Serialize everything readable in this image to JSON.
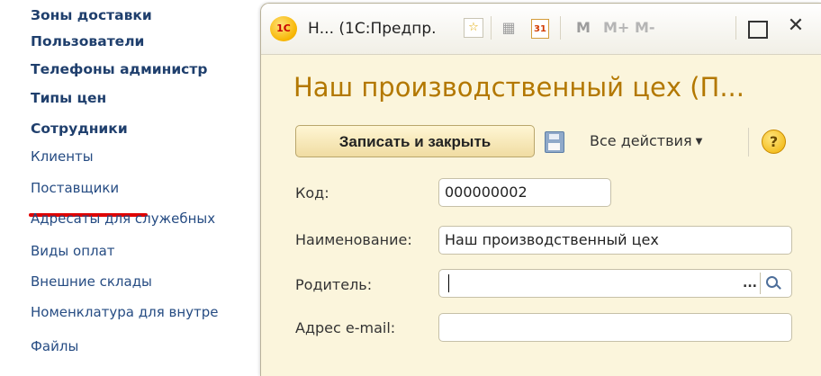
{
  "nav": {
    "items": [
      {
        "label": "Зоны доставки",
        "style": "bold"
      },
      {
        "label": "Пользователи",
        "style": "bold"
      },
      {
        "label": "Телефоны администр",
        "style": "bold"
      },
      {
        "label": "Типы цен",
        "style": "bold"
      },
      {
        "label": "Сотрудники",
        "style": "bold"
      },
      {
        "label": "Клиенты",
        "style": "link"
      },
      {
        "label": "Поставщики",
        "style": "link"
      },
      {
        "label": "Адресаты для служебных",
        "style": "link"
      },
      {
        "label": "Виды оплат",
        "style": "link"
      },
      {
        "label": "Внешние склады",
        "style": "link"
      },
      {
        "label": "Номенклатура для внутре",
        "style": "link"
      },
      {
        "label": "Файлы",
        "style": "link"
      }
    ]
  },
  "window": {
    "logo": "1С",
    "title": "Н...  (1С:Предпр.",
    "icons": {
      "star": "☆",
      "calculator": "▦",
      "calendar": "31",
      "m": "M",
      "m_plus": "M+",
      "m_minus": "M-",
      "close": "✕"
    }
  },
  "form": {
    "title": "Наш производственный цех (П...",
    "toolbar": {
      "save_close_label": "Записать и закрыть",
      "all_actions_label": "Все действия",
      "help": "?"
    },
    "fields": {
      "code_label": "Код:",
      "code_value": "000000002",
      "name_label": "Наименование:",
      "name_value": "Наш производственный цех",
      "parent_label": "Родитель:",
      "parent_value": "",
      "parent_dots": "...",
      "email_label": "Адрес e-mail:",
      "email_value": ""
    }
  },
  "colors": {
    "form_title": "#b37800",
    "dialog_bg": "#fbf5dc",
    "nav_text": "#1f3f6d",
    "underline": "#e00000"
  }
}
